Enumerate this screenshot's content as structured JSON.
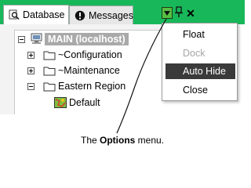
{
  "tabs": [
    {
      "label": "Database",
      "icon": "database-search-icon",
      "active": true
    },
    {
      "label": "Messages",
      "icon": "info-icon",
      "active": false
    }
  ],
  "toolbar": {
    "options_icon": "options-dropdown-icon",
    "pin_icon": "pin-icon",
    "close_label": "✕"
  },
  "tree": {
    "root": {
      "label": "MAIN (localhost)",
      "icon": "server-icon"
    },
    "children": [
      {
        "label": "~Configuration",
        "icon": "folder-icon"
      },
      {
        "label": "~Maintenance",
        "icon": "folder-icon"
      },
      {
        "label": "Eastern Region",
        "icon": "folder-icon"
      },
      {
        "label": "Default",
        "icon": "map-icon"
      }
    ]
  },
  "menu": {
    "items": [
      {
        "label": "Float",
        "state": "normal"
      },
      {
        "label": "Dock",
        "state": "disabled"
      },
      {
        "label": "Auto Hide",
        "state": "highlighted"
      },
      {
        "label": "Close",
        "state": "normal"
      }
    ]
  },
  "caption": {
    "prefix": "The ",
    "bold": "Options",
    "suffix": " menu."
  },
  "colors": {
    "tab_strip": "#18b85a",
    "options_button": "#56c043",
    "highlight": "#3a3a3a",
    "disabled_text": "#a6a6a6"
  }
}
